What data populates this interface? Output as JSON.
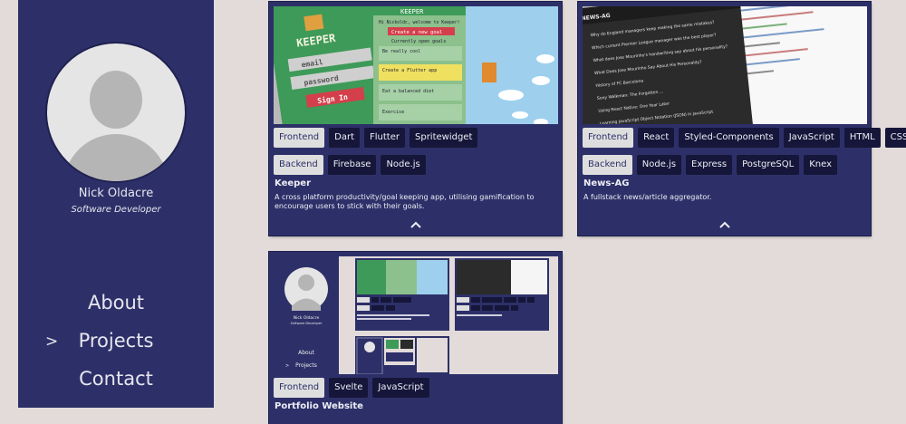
{
  "profile": {
    "name": "Nick Oldacre",
    "role": "Software Developer"
  },
  "nav": {
    "marker": ">",
    "items": [
      "About",
      "Projects",
      "Contact"
    ],
    "active": "Projects"
  },
  "tag_categories": {
    "frontend": "Frontend",
    "backend": "Backend"
  },
  "projects": [
    {
      "title": "Keeper",
      "description": "A cross platform productivity/goal keeping app, utilising gamification to encourage users to stick with their goals.",
      "frontend": [
        "Dart",
        "Flutter",
        "Spritewidget"
      ],
      "backend": [
        "Firebase",
        "Node.js"
      ],
      "screenshot_text": {
        "logo": "KEEPER",
        "email": "email",
        "password": "password",
        "signin": "Sign In",
        "header": "KEEPER",
        "welcome": "Hi Nickoldc, welcome to Keeper!",
        "create": "Create a new goal",
        "open": "Currently open goals",
        "goal1": "Be really cool",
        "goal2": "Create a Flutter app",
        "goal3": "Eat a balanced diet",
        "goal4": "Exercise"
      }
    },
    {
      "title": "News-AG",
      "description": "A fullstack news/article aggregator.",
      "frontend": [
        "React",
        "Styled-Components",
        "JavaScript",
        "HTML",
        "CSS"
      ],
      "backend": [
        "Node.js",
        "Express",
        "PostgreSQL",
        "Knex"
      ],
      "screenshot_text": {
        "brand": "NEWS-AG",
        "a1": "Why do England managers keep making the same mistakes?",
        "a2": "Which current Premier League manager was the best player?",
        "a3": "What does Jose Mourinho's handwriting say about his personality?",
        "a4": "What Does Jose Mourinho Say About His Personality?",
        "a5": "History of FC Barcelona",
        "a6": "Sony Walkman: The Forgotten ...",
        "a7": "Using React Native: One Year Later",
        "a8": "Learning JavaScript Object Notation (JSON) in JavaScript"
      }
    },
    {
      "title": "Portfolio Website",
      "frontend": [
        "Svelte",
        "JavaScript"
      ],
      "screenshot_text": {
        "name": "Nick Oldacre",
        "role": "Software Developer",
        "about": "About",
        "projects": "Projects",
        "marker": ">"
      }
    }
  ],
  "colors": {
    "page_bg": "#e2dbda",
    "panel": "#2d3068",
    "tag_dark": "#16163a",
    "tag_light": "#dedede"
  }
}
